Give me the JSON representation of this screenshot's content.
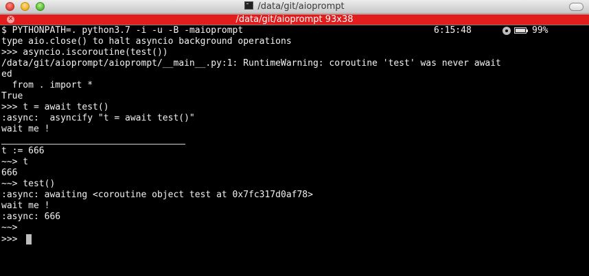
{
  "window": {
    "title": "/data/git/aioprompt"
  },
  "tab": {
    "label": "/data/git/aioprompt 93x38",
    "close_icon": "close-x"
  },
  "status": {
    "time": "6:15:48",
    "battery": "99%",
    "battery_level": 0.99,
    "icons": [
      "radiation-icon",
      "battery-icon"
    ]
  },
  "terminal": {
    "lines": [
      "$ PYTHONPATH=. python3.7 -i -u -B -maioprompt",
      "type aio.close() to halt asyncio background operations",
      ">>> asyncio.iscoroutine(test())",
      "/data/git/aioprompt/aioprompt/__main__.py:1: RuntimeWarning: coroutine 'test' was never await",
      "ed",
      "  from . import *",
      "True",
      ">>> t = await test()",
      ":async:  asyncify \"t = await test()\"",
      "wait me !",
      "",
      "t := 666",
      "~~> t",
      "666",
      "~~> test()",
      ":async: awaiting <coroutine object test at 0x7fc317d0af78>",
      "wait me !",
      ":async: 666",
      "~~>",
      ">>> "
    ]
  },
  "colors": {
    "tab_bg": "#e11d1d",
    "terminal_bg": "#000000",
    "terminal_fg": "#f2f2f2"
  }
}
